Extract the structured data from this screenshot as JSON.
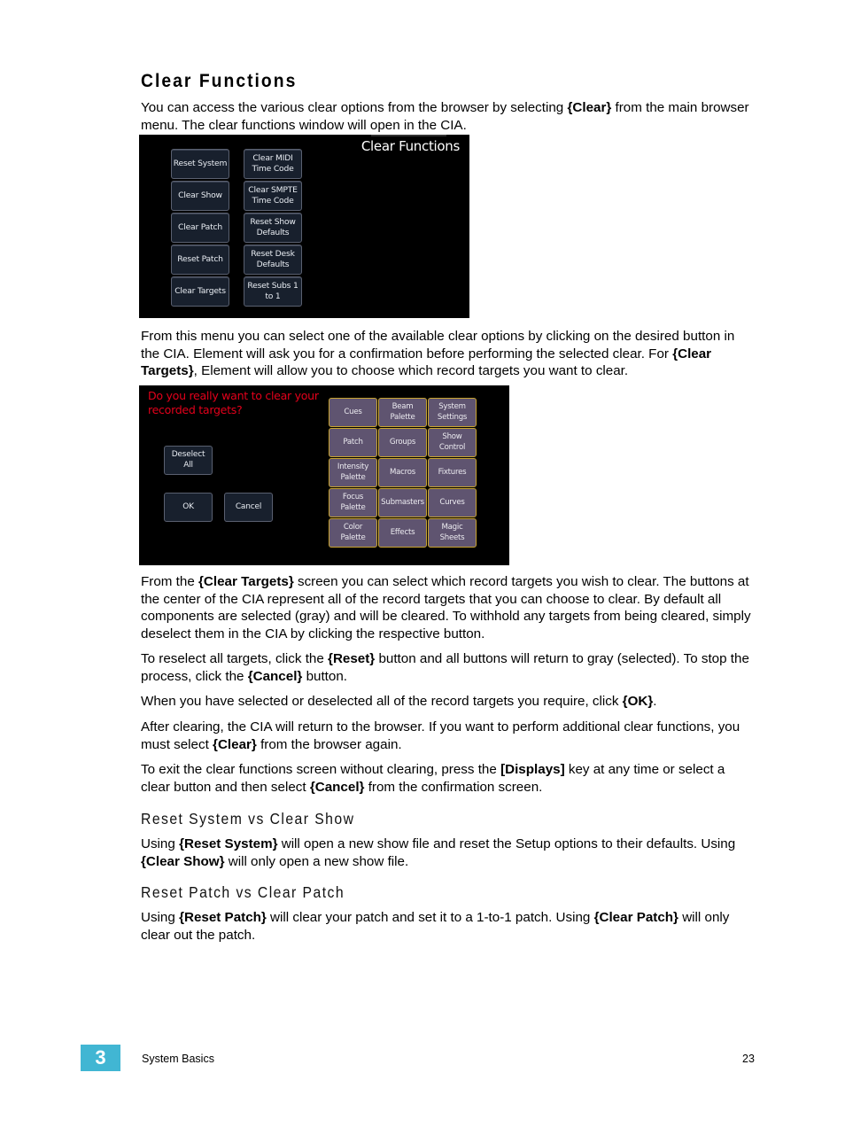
{
  "heading": "Clear Functions",
  "paragraphs": {
    "p1": [
      {
        "t": "You can access the various clear options from the browser by selecting "
      },
      {
        "t": "{Clear}",
        "b": true
      },
      {
        "t": " from the main browser menu. The clear functions window will open in the CIA."
      }
    ],
    "p2": [
      {
        "t": "From this menu you can select one of the available clear options by clicking on the desired button in the CIA. Element will ask you for a confirmation before performing the selected clear. For "
      },
      {
        "t": "{Clear Targets}",
        "b": true
      },
      {
        "t": ", Element will allow you to choose which record targets you want to clear."
      }
    ],
    "p3": [
      {
        "t": "From the "
      },
      {
        "t": "{Clear Targets}",
        "b": true
      },
      {
        "t": " screen you can select which record targets you wish to clear. The buttons at the center of the CIA represent all of the record targets that you can choose to clear. By default all components are selected (gray) and will be cleared. To withhold any targets from being cleared, simply deselect them in the CIA by clicking the respective button."
      }
    ],
    "p4": [
      {
        "t": "To reselect all targets, click the "
      },
      {
        "t": "{Reset}",
        "b": true
      },
      {
        "t": " button and all buttons will return to gray (selected). To stop the process, click the "
      },
      {
        "t": "{Cancel}",
        "b": true
      },
      {
        "t": " button."
      }
    ],
    "p5": [
      {
        "t": "When you have selected or deselected all of the record targets you require, click "
      },
      {
        "t": "{OK}",
        "b": true
      },
      {
        "t": "."
      }
    ],
    "p6": [
      {
        "t": "After clearing, the CIA will return to the browser. If you want to perform additional clear functions, you must select "
      },
      {
        "t": "{Clear}",
        "b": true
      },
      {
        "t": " from the browser again."
      }
    ],
    "p7": [
      {
        "t": "To exit the clear functions screen without clearing, press the "
      },
      {
        "t": "[Displays]",
        "b": true
      },
      {
        "t": " key at any time or select a clear button and then select "
      },
      {
        "t": "{Cancel}",
        "b": true
      },
      {
        "t": " from the confirmation screen."
      }
    ],
    "p8": [
      {
        "t": "Using "
      },
      {
        "t": "{Reset System}",
        "b": true
      },
      {
        "t": " will open a new show file and reset the Setup options to their defaults. Using "
      },
      {
        "t": "{Clear Show}",
        "b": true
      },
      {
        "t": " will only open a new show file."
      }
    ],
    "p9": [
      {
        "t": "Using "
      },
      {
        "t": "{Reset Patch}",
        "b": true
      },
      {
        "t": " will clear your patch and set it to a 1-to-1 patch. Using "
      },
      {
        "t": "{Clear Patch}",
        "b": true
      },
      {
        "t": " will only clear out the patch."
      }
    ]
  },
  "subheadings": {
    "s1": "Reset System vs Clear Show",
    "s2": "Reset Patch vs Clear Patch"
  },
  "clear_functions_screen": {
    "title": "Clear Functions",
    "left_column": [
      "Reset System",
      "Clear Show",
      "Clear Patch",
      "Reset Patch",
      "Clear Targets"
    ],
    "right_column": [
      "Clear MIDI\nTime Code",
      "Clear SMPTE\nTime Code",
      "Reset Show\nDefaults",
      "Reset Desk\nDefaults",
      "Reset Subs 1\nto 1"
    ]
  },
  "clear_targets_screen": {
    "question": "Do you really want to clear your recorded targets?",
    "deselect_all": "Deselect\nAll",
    "ok": "OK",
    "cancel": "Cancel",
    "targets": [
      "Cues",
      "Beam\nPalette",
      "System\nSettings",
      "Patch",
      "Groups",
      "Show\nControl",
      "Intensity\nPalette",
      "Macros",
      "Fixtures",
      "Focus\nPalette",
      "Submasters",
      "Curves",
      "Color\nPalette",
      "Effects",
      "Magic\nSheets"
    ]
  },
  "colors": {
    "chapter_tab": "#41b6d3",
    "question_text": "#e3001b",
    "target_button_fill": "#5f5470",
    "target_button_border": "#c9a431",
    "function_button_fill": "#18202d"
  },
  "footer": {
    "chapter_number": "3",
    "section": "System Basics",
    "page_number": "23"
  }
}
